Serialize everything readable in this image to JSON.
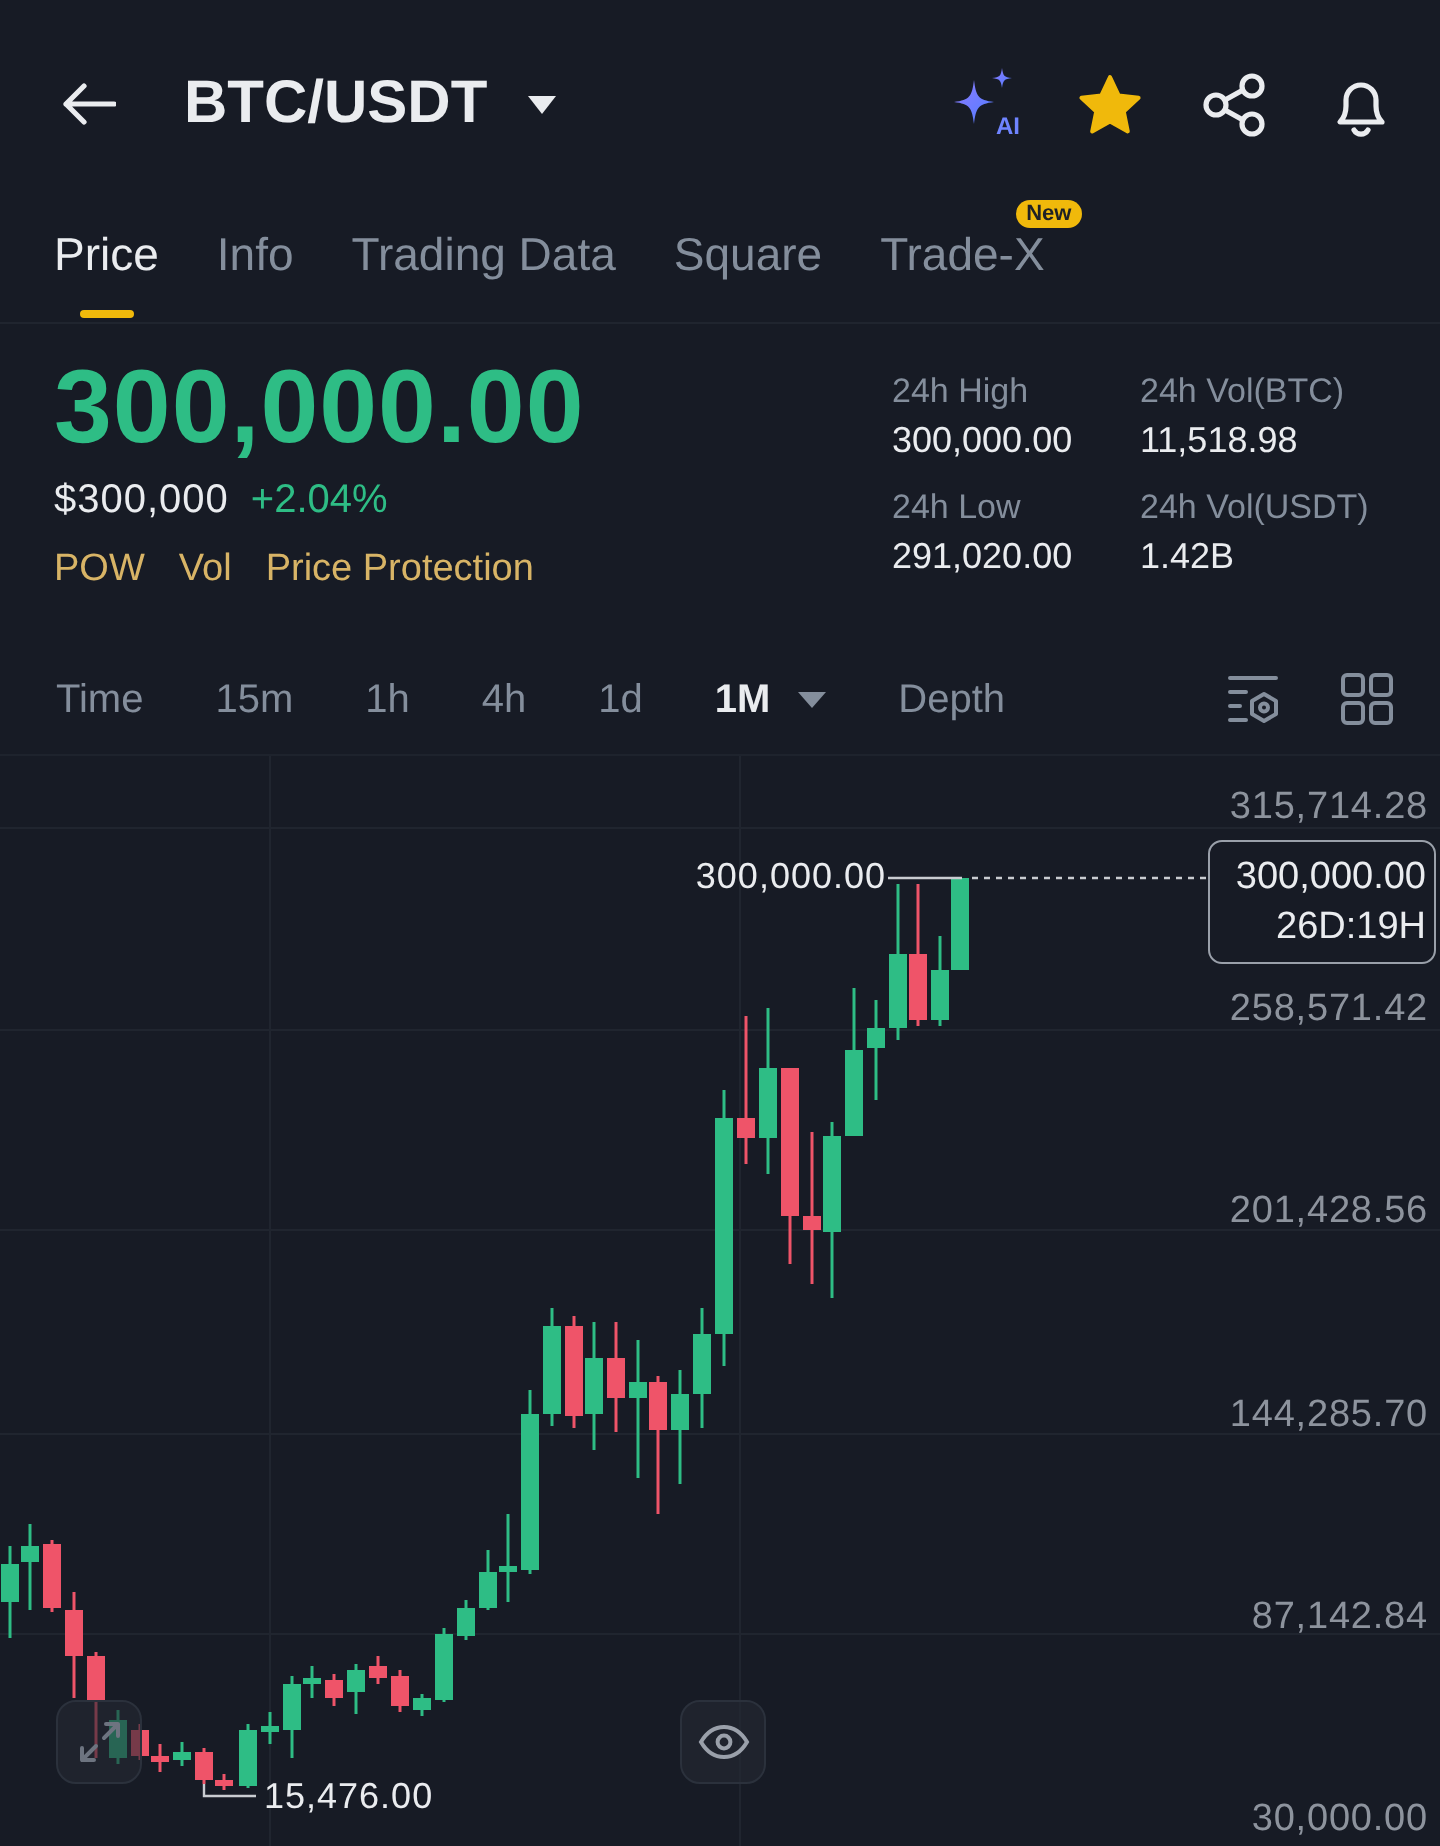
{
  "header": {
    "pair": "BTC/USDT",
    "ai_label": "AI",
    "favorited": true
  },
  "tabs": [
    {
      "label": "Price",
      "selected": true
    },
    {
      "label": "Info",
      "selected": false
    },
    {
      "label": "Trading Data",
      "selected": false
    },
    {
      "label": "Square",
      "selected": false
    },
    {
      "label": "Trade-X",
      "selected": false,
      "badge": "New"
    }
  ],
  "ticker": {
    "last_price": "300,000.00",
    "rising": true,
    "fiat_price": "$300,000",
    "change": "+2.04%",
    "tags": [
      "POW",
      "Vol",
      "Price Protection"
    ]
  },
  "stats": [
    {
      "label": "24h High",
      "value": "300,000.00"
    },
    {
      "label": "24h Vol(BTC)",
      "value": "11,518.98"
    },
    {
      "label": "24h Low",
      "value": "291,020.00"
    },
    {
      "label": "24h Vol(USDT)",
      "value": "1.42B"
    }
  ],
  "intervals": [
    {
      "label": "Time",
      "selected": false,
      "has_menu": false
    },
    {
      "label": "15m",
      "selected": false,
      "has_menu": false
    },
    {
      "label": "1h",
      "selected": false,
      "has_menu": false
    },
    {
      "label": "4h",
      "selected": false,
      "has_menu": false
    },
    {
      "label": "1d",
      "selected": false,
      "has_menu": false
    },
    {
      "label": "1M",
      "selected": true,
      "has_menu": true
    },
    {
      "label": "Depth",
      "selected": false,
      "has_menu": false
    }
  ],
  "chart": {
    "price_axis": [
      "315,714.28",
      "258,571.42",
      "201,428.56",
      "144,285.70",
      "87,142.84",
      "30,000.00"
    ],
    "high_label": "300,000.00",
    "low_label": "15,476.00",
    "last_price_tag": {
      "price": "300,000.00",
      "countdown": "26D:19H"
    }
  }
}
